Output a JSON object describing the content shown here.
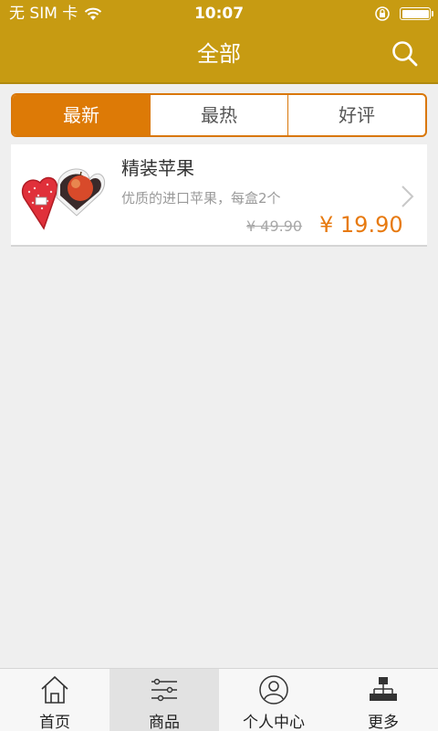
{
  "status_bar": {
    "carrier": "无 SIM 卡",
    "time": "10:07",
    "icons": [
      "wifi-icon",
      "rotation-lock-icon",
      "battery-icon"
    ]
  },
  "navbar": {
    "title": "全部",
    "search_icon": "search-icon"
  },
  "tabs": [
    {
      "label": "最新",
      "active": true
    },
    {
      "label": "最热",
      "active": false
    },
    {
      "label": "好评",
      "active": false
    }
  ],
  "products": [
    {
      "name": "精装苹果",
      "description": "优质的进口苹果，每盒2个",
      "old_price": "¥ 49.90",
      "price": "¥ 19.90",
      "image": "apple-gift-box-image"
    }
  ],
  "bottom_nav": [
    {
      "label": "首页",
      "icon": "home-icon",
      "active": false
    },
    {
      "label": "商品",
      "icon": "list-icon",
      "active": true
    },
    {
      "label": "个人中心",
      "icon": "user-icon",
      "active": false
    },
    {
      "label": "更多",
      "icon": "more-icon",
      "active": false
    }
  ],
  "colors": {
    "header": "#c79b12",
    "accent": "#dd7a06",
    "price": "#e77a10",
    "background": "#efefef"
  }
}
